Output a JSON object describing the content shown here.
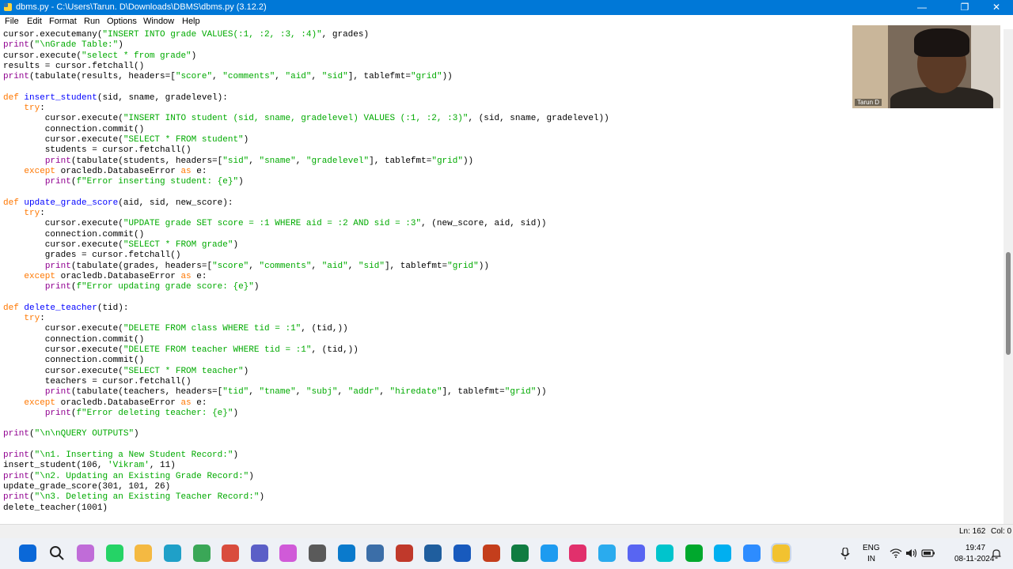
{
  "window": {
    "title": "dbms.py - C:\\Users\\Tarun. D\\Downloads\\DBMS\\dbms.py (3.12.2)",
    "controls": [
      "—",
      "❐",
      "✕"
    ]
  },
  "menu": [
    "File",
    "Edit",
    "Format",
    "Run",
    "Options",
    "Window",
    "Help"
  ],
  "code": [
    [
      [
        "cursor.executemany(",
        ""
      ],
      [
        "\"INSERT INTO grade VALUES(:1, :2, :3, :4)\"",
        "st"
      ],
      [
        ", grades)",
        ""
      ]
    ],
    [
      [
        "print",
        "bi"
      ],
      [
        "(",
        ""
      ],
      [
        "\"\\nGrade Table:\"",
        "st"
      ],
      [
        ")",
        ""
      ]
    ],
    [
      [
        "cursor.execute(",
        ""
      ],
      [
        "\"select * from grade\"",
        "st"
      ],
      [
        ")",
        ""
      ]
    ],
    [
      [
        "results = cursor.fetchall()",
        ""
      ]
    ],
    [
      [
        "print",
        "bi"
      ],
      [
        "(tabulate(results, headers=[",
        ""
      ],
      [
        "\"score\"",
        "st"
      ],
      [
        ", ",
        ""
      ],
      [
        "\"comments\"",
        "st"
      ],
      [
        ", ",
        ""
      ],
      [
        "\"aid\"",
        "st"
      ],
      [
        ", ",
        ""
      ],
      [
        "\"sid\"",
        "st"
      ],
      [
        "], tablefmt=",
        ""
      ],
      [
        "\"grid\"",
        "st"
      ],
      [
        "))",
        ""
      ]
    ],
    [],
    [
      [
        "def",
        "kw"
      ],
      [
        " ",
        ""
      ],
      [
        "insert_student",
        "df"
      ],
      [
        "(sid, sname, gradelevel):",
        ""
      ]
    ],
    [
      [
        "    ",
        ""
      ],
      [
        "try",
        "kw"
      ],
      [
        ":",
        ""
      ]
    ],
    [
      [
        "        cursor.execute(",
        ""
      ],
      [
        "\"INSERT INTO student (sid, sname, gradelevel) VALUES (:1, :2, :3)\"",
        "st"
      ],
      [
        ", (sid, sname, gradelevel))",
        ""
      ]
    ],
    [
      [
        "        connection.commit()",
        ""
      ]
    ],
    [
      [
        "        cursor.execute(",
        ""
      ],
      [
        "\"SELECT * FROM student\"",
        "st"
      ],
      [
        ")",
        ""
      ]
    ],
    [
      [
        "        students = cursor.fetchall()",
        ""
      ]
    ],
    [
      [
        "        ",
        ""
      ],
      [
        "print",
        "bi"
      ],
      [
        "(tabulate(students, headers=[",
        ""
      ],
      [
        "\"sid\"",
        "st"
      ],
      [
        ", ",
        ""
      ],
      [
        "\"sname\"",
        "st"
      ],
      [
        ", ",
        ""
      ],
      [
        "\"gradelevel\"",
        "st"
      ],
      [
        "], tablefmt=",
        ""
      ],
      [
        "\"grid\"",
        "st"
      ],
      [
        "))",
        ""
      ]
    ],
    [
      [
        "    ",
        ""
      ],
      [
        "except",
        "kw"
      ],
      [
        " oracledb.DatabaseError ",
        ""
      ],
      [
        "as",
        "kw"
      ],
      [
        " e:",
        ""
      ]
    ],
    [
      [
        "        ",
        ""
      ],
      [
        "print",
        "bi"
      ],
      [
        "(",
        ""
      ],
      [
        "f\"Error inserting student: {e}\"",
        "st"
      ],
      [
        ")",
        ""
      ]
    ],
    [],
    [
      [
        "def",
        "kw"
      ],
      [
        " ",
        ""
      ],
      [
        "update_grade_score",
        "df"
      ],
      [
        "(aid, sid, new_score):",
        ""
      ]
    ],
    [
      [
        "    ",
        ""
      ],
      [
        "try",
        "kw"
      ],
      [
        ":",
        ""
      ]
    ],
    [
      [
        "        cursor.execute(",
        ""
      ],
      [
        "\"UPDATE grade SET score = :1 WHERE aid = :2 AND sid = :3\"",
        "st"
      ],
      [
        ", (new_score, aid, sid))",
        ""
      ]
    ],
    [
      [
        "        connection.commit()",
        ""
      ]
    ],
    [
      [
        "        cursor.execute(",
        ""
      ],
      [
        "\"SELECT * FROM grade\"",
        "st"
      ],
      [
        ")",
        ""
      ]
    ],
    [
      [
        "        grades = cursor.fetchall()",
        ""
      ]
    ],
    [
      [
        "        ",
        ""
      ],
      [
        "print",
        "bi"
      ],
      [
        "(tabulate(grades, headers=[",
        ""
      ],
      [
        "\"score\"",
        "st"
      ],
      [
        ", ",
        ""
      ],
      [
        "\"comments\"",
        "st"
      ],
      [
        ", ",
        ""
      ],
      [
        "\"aid\"",
        "st"
      ],
      [
        ", ",
        ""
      ],
      [
        "\"sid\"",
        "st"
      ],
      [
        "], tablefmt=",
        ""
      ],
      [
        "\"grid\"",
        "st"
      ],
      [
        "))",
        ""
      ]
    ],
    [
      [
        "    ",
        ""
      ],
      [
        "except",
        "kw"
      ],
      [
        " oracledb.DatabaseError ",
        ""
      ],
      [
        "as",
        "kw"
      ],
      [
        " e:",
        ""
      ]
    ],
    [
      [
        "        ",
        ""
      ],
      [
        "print",
        "bi"
      ],
      [
        "(",
        ""
      ],
      [
        "f\"Error updating grade score: {e}\"",
        "st"
      ],
      [
        ")",
        ""
      ]
    ],
    [],
    [
      [
        "def",
        "kw"
      ],
      [
        " ",
        ""
      ],
      [
        "delete_teacher",
        "df"
      ],
      [
        "(tid):",
        ""
      ]
    ],
    [
      [
        "    ",
        ""
      ],
      [
        "try",
        "kw"
      ],
      [
        ":",
        ""
      ]
    ],
    [
      [
        "        cursor.execute(",
        ""
      ],
      [
        "\"DELETE FROM class WHERE tid = :1\"",
        "st"
      ],
      [
        ", (tid,))",
        ""
      ]
    ],
    [
      [
        "        connection.commit()",
        ""
      ]
    ],
    [
      [
        "        cursor.execute(",
        ""
      ],
      [
        "\"DELETE FROM teacher WHERE tid = :1\"",
        "st"
      ],
      [
        ", (tid,))",
        ""
      ]
    ],
    [
      [
        "        connection.commit()",
        ""
      ]
    ],
    [
      [
        "        cursor.execute(",
        ""
      ],
      [
        "\"SELECT * FROM teacher\"",
        "st"
      ],
      [
        ")",
        ""
      ]
    ],
    [
      [
        "        teachers = cursor.fetchall()",
        ""
      ]
    ],
    [
      [
        "        ",
        ""
      ],
      [
        "print",
        "bi"
      ],
      [
        "(tabulate(teachers, headers=[",
        ""
      ],
      [
        "\"tid\"",
        "st"
      ],
      [
        ", ",
        ""
      ],
      [
        "\"tname\"",
        "st"
      ],
      [
        ", ",
        ""
      ],
      [
        "\"subj\"",
        "st"
      ],
      [
        ", ",
        ""
      ],
      [
        "\"addr\"",
        "st"
      ],
      [
        ", ",
        ""
      ],
      [
        "\"hiredate\"",
        "st"
      ],
      [
        "], tablefmt=",
        ""
      ],
      [
        "\"grid\"",
        "st"
      ],
      [
        "))",
        ""
      ]
    ],
    [
      [
        "    ",
        ""
      ],
      [
        "except",
        "kw"
      ],
      [
        " oracledb.DatabaseError ",
        ""
      ],
      [
        "as",
        "kw"
      ],
      [
        " e:",
        ""
      ]
    ],
    [
      [
        "        ",
        ""
      ],
      [
        "print",
        "bi"
      ],
      [
        "(",
        ""
      ],
      [
        "f\"Error deleting teacher: {e}\"",
        "st"
      ],
      [
        ")",
        ""
      ]
    ],
    [],
    [
      [
        "print",
        "bi"
      ],
      [
        "(",
        ""
      ],
      [
        "\"\\n\\nQUERY OUTPUTS\"",
        "st"
      ],
      [
        ")",
        ""
      ]
    ],
    [],
    [
      [
        "print",
        "bi"
      ],
      [
        "(",
        ""
      ],
      [
        "\"\\n1. Inserting a New Student Record:\"",
        "st"
      ],
      [
        ")",
        ""
      ]
    ],
    [
      [
        "insert_student(106, ",
        ""
      ],
      [
        "'Vikram'",
        "st"
      ],
      [
        ", 11)",
        ""
      ]
    ],
    [
      [
        "print",
        "bi"
      ],
      [
        "(",
        ""
      ],
      [
        "\"\\n2. Updating an Existing Grade Record:\"",
        "st"
      ],
      [
        ")",
        ""
      ]
    ],
    [
      [
        "update_grade_score(301, 101, 26)",
        ""
      ]
    ],
    [
      [
        "print",
        "bi"
      ],
      [
        "(",
        ""
      ],
      [
        "\"\\n3. Deleting an Existing Teacher Record:\"",
        "st"
      ],
      [
        ")",
        ""
      ]
    ],
    [
      [
        "delete_teacher(1001)",
        ""
      ]
    ]
  ],
  "webcam": {
    "name": "Tarun D"
  },
  "status": {
    "line": "Ln: 162",
    "col": "Col: 0"
  },
  "taskbar": {
    "apps": [
      {
        "icon": "windows-start-icon",
        "color": "#0a68d8"
      },
      {
        "icon": "search-icon",
        "color": "#222222"
      },
      {
        "icon": "copilot-icon",
        "color": "#c06cd8"
      },
      {
        "icon": "whatsapp-icon",
        "color": "#25d366"
      },
      {
        "icon": "file-explorer-icon",
        "color": "#f4b942"
      },
      {
        "icon": "edge-icon",
        "color": "#1fa0c8"
      },
      {
        "icon": "chrome-icon",
        "color": "#3aa757"
      },
      {
        "icon": "chrome-profile-icon",
        "color": "#d94c3d"
      },
      {
        "icon": "teams-icon",
        "color": "#5b5fc7"
      },
      {
        "icon": "snipping-tool-icon",
        "color": "#d05ad8"
      },
      {
        "icon": "calculator-icon",
        "color": "#5a5a5a"
      },
      {
        "icon": "vscode-icon",
        "color": "#0a7acc"
      },
      {
        "icon": "media-player-icon",
        "color": "#3b6ea8"
      },
      {
        "icon": "projectlibre-icon",
        "color": "#c0392b"
      },
      {
        "icon": "virtualbox-icon",
        "color": "#1f5e9e"
      },
      {
        "icon": "word-icon",
        "color": "#185abd"
      },
      {
        "icon": "powerpoint-icon",
        "color": "#c43e1c"
      },
      {
        "icon": "excel-icon",
        "color": "#107c41"
      },
      {
        "icon": "twitter-icon",
        "color": "#1d9bf0"
      },
      {
        "icon": "instagram-icon",
        "color": "#e1306c"
      },
      {
        "icon": "telegram-icon",
        "color": "#2aabee"
      },
      {
        "icon": "discord-icon",
        "color": "#5865f2"
      },
      {
        "icon": "canva-icon",
        "color": "#00c4cc"
      },
      {
        "icon": "evernote-icon",
        "color": "#00a82d"
      },
      {
        "icon": "skype-icon",
        "color": "#00aff0"
      },
      {
        "icon": "zoom-icon",
        "color": "#2d8cff"
      },
      {
        "icon": "python-idle-icon",
        "color": "#f2c230"
      }
    ],
    "lang_top": "ENG",
    "lang_bottom": "IN",
    "time": "19:47",
    "date": "08-11-2024"
  }
}
